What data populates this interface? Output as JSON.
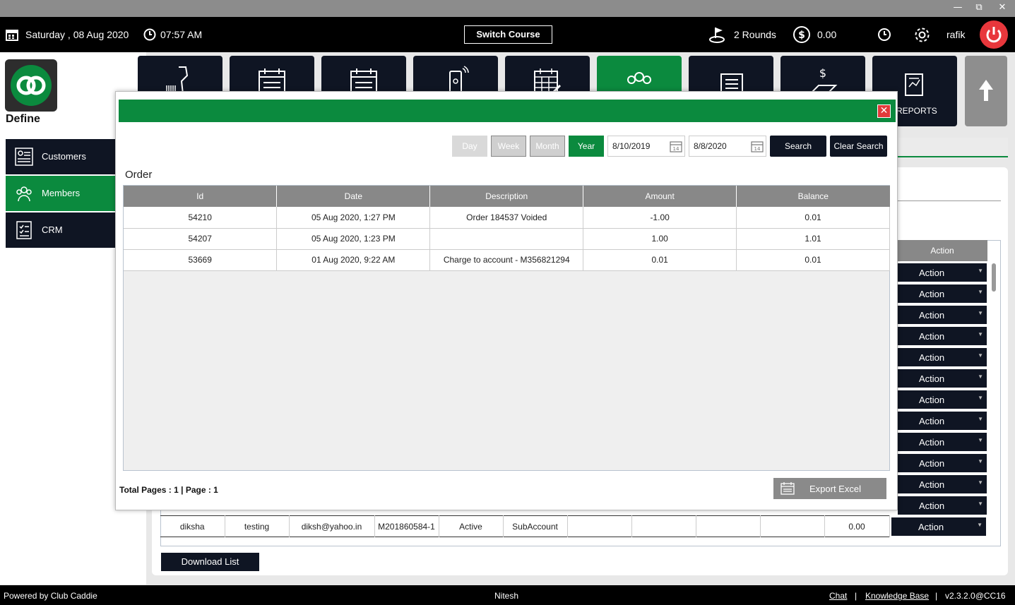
{
  "window": {
    "minimize": "—",
    "maximize": "⧉",
    "close": "✕"
  },
  "topbar": {
    "date": "Saturday ,  08 Aug 2020",
    "time": "07:57 AM",
    "switch_course": "Switch Course",
    "rounds": "2 Rounds",
    "balance": "0.00",
    "user": "rafik"
  },
  "sidebar": {
    "section_title": "Define",
    "items": [
      {
        "label": "Customers"
      },
      {
        "label": "Members"
      },
      {
        "label": "CRM"
      }
    ]
  },
  "tiles": {
    "reports_label": "REPORTS"
  },
  "modal": {
    "filters": {
      "day": "Day",
      "week": "Week",
      "month": "Month",
      "year": "Year"
    },
    "from_date": "8/10/2019",
    "to_date": "8/8/2020",
    "search": "Search",
    "clear_search": "Clear Search",
    "title": "Order",
    "columns": [
      "Id",
      "Date",
      "Description",
      "Amount",
      "Balance"
    ],
    "rows": [
      [
        "54210",
        "05 Aug 2020, 1:27 PM",
        "Order 184537 Voided",
        "-1.00",
        "0.01"
      ],
      [
        "54207",
        "05 Aug 2020, 1:23 PM",
        "",
        "1.00",
        "1.01"
      ],
      [
        "53669",
        "01 Aug 2020, 9:22 AM",
        "Charge to account - M356821294",
        "0.01",
        "0.01"
      ]
    ],
    "totals": "Total Pages : 1 | Page : 1",
    "export": "Export Excel"
  },
  "background_table": {
    "action_header": "Action",
    "action_label": "Action",
    "row": [
      "diksha",
      "testing",
      "diksh@yahoo.in",
      "M201860584-1",
      "Active",
      "SubAccount",
      "",
      "",
      "",
      "",
      "0.00"
    ]
  },
  "download_list": "Download List",
  "footer": {
    "powered": "Powered by Club Caddie",
    "user": "Nitesh",
    "chat": "Chat",
    "sep1": "|",
    "kb": "Knowledge Base",
    "sep2": "|",
    "version": "v2.3.2.0@CC16"
  },
  "colors": {
    "green": "#0b8a3e",
    "dark": "#0f1523",
    "red": "#e8373c"
  }
}
